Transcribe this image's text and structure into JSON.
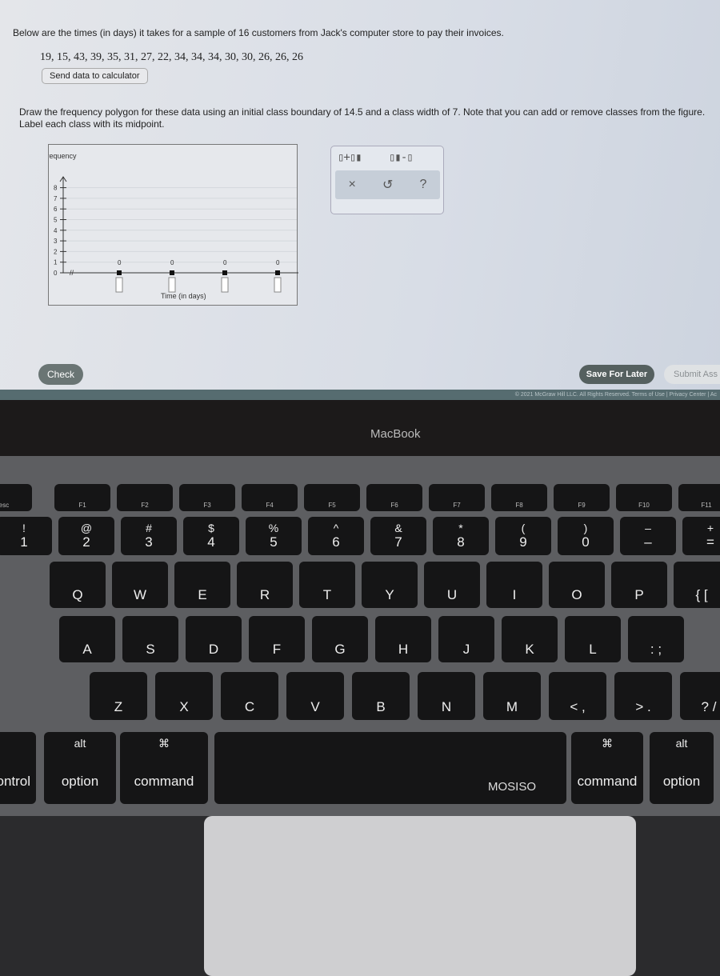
{
  "question": {
    "intro": "Below are the times (in days) it takes for a sample of 16 customers from Jack's computer store to pay their invoices.",
    "values": "19, 15, 43, 39, 35, 31, 27, 22, 34, 34, 34, 30, 30, 26, 26, 26",
    "send_button": "Send data to calculator",
    "instructions": "Draw the frequency polygon for these data using an initial class boundary of 14.5 and a class width of 7. Note that you can add or remove classes from the figure. Label each class with its midpoint."
  },
  "graph": {
    "ylabel": "Frequency",
    "xlabel": "Time (in days)",
    "y_ticks": [
      "0",
      "1",
      "2",
      "3",
      "4",
      "5",
      "6",
      "7",
      "8"
    ],
    "point_values": [
      "0",
      "0",
      "0",
      "0"
    ]
  },
  "toolbox": {
    "add_class_icon": "add-class-icon",
    "remove_class_icon": "remove-class-icon",
    "clear": "×",
    "undo": "↺",
    "help": "?"
  },
  "buttons": {
    "check": "Check",
    "save": "Save For Later",
    "submit": "Submit Ass"
  },
  "footer": "© 2021 McGraw Hill LLC. All Rights Reserved.   Terms of Use  |  Privacy Center  |  Ac",
  "laptop": {
    "brand": "MacBook"
  },
  "keyboard": {
    "function_row": [
      "esc",
      "F1",
      "F2",
      "F3",
      "F4",
      "F5",
      "F6",
      "F7",
      "F8",
      "F9",
      "F10",
      "F11"
    ],
    "number_row": [
      [
        "!",
        "1"
      ],
      [
        "@",
        "2"
      ],
      [
        "#",
        "3"
      ],
      [
        "$",
        "4"
      ],
      [
        "%",
        "5"
      ],
      [
        "^",
        "6"
      ],
      [
        "&",
        "7"
      ],
      [
        "*",
        "8"
      ],
      [
        "(",
        "9"
      ],
      [
        ")",
        "0"
      ],
      [
        "–",
        "–"
      ],
      [
        "+",
        "="
      ]
    ],
    "qwerty_row": [
      "Q",
      "W",
      "E",
      "R",
      "T",
      "Y",
      "U",
      "I",
      "O",
      "P",
      "{ ["
    ],
    "home_row": [
      "A",
      "S",
      "D",
      "F",
      "G",
      "H",
      "J",
      "K",
      "L",
      ": ;"
    ],
    "bottom_letters": [
      "Z",
      "X",
      "C",
      "V",
      "B",
      "N",
      "M",
      "< ,",
      "> .",
      "? /"
    ],
    "modifiers": [
      [
        "",
        "control"
      ],
      [
        "alt",
        "option"
      ],
      [
        "⌘",
        "command"
      ],
      [
        "",
        ""
      ],
      [
        "⌘",
        "command"
      ],
      [
        "alt",
        "option"
      ]
    ],
    "sticker": "MOSISO"
  }
}
